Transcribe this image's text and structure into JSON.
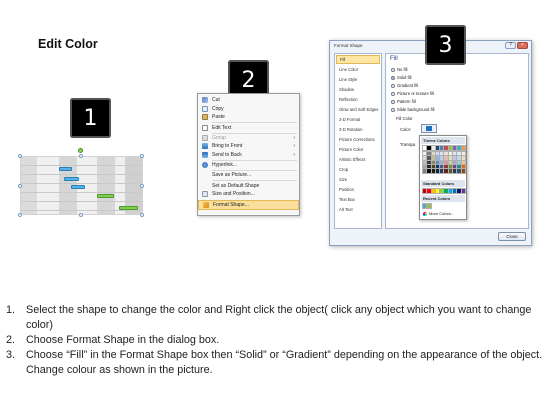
{
  "title": "Edit Color",
  "steps": {
    "one": "1",
    "two": "2",
    "three": "3"
  },
  "context_menu": {
    "items": [
      {
        "label": "Cut",
        "icon": "scissors-icon",
        "dim": false
      },
      {
        "label": "Copy",
        "icon": "copy-icon",
        "dim": false
      },
      {
        "label": "Paste",
        "icon": "paste-icon",
        "dim": false
      },
      {
        "label": "Edit Text",
        "icon": "edit-text-icon",
        "dim": false
      },
      {
        "label": "Group",
        "icon": "group-icon",
        "dim": true,
        "submenu": true
      },
      {
        "label": "Bring to Front",
        "icon": "bring-front-icon",
        "dim": false,
        "submenu": true
      },
      {
        "label": "Send to Back",
        "icon": "send-back-icon",
        "dim": false,
        "submenu": true
      },
      {
        "label": "Hyperlink...",
        "icon": "hyperlink-icon",
        "dim": false
      },
      {
        "label": "Save as Picture...",
        "icon": "",
        "dim": false
      },
      {
        "label": "Set as Default Shape",
        "icon": "",
        "dim": false
      },
      {
        "label": "Size and Position...",
        "icon": "size-icon",
        "dim": false
      },
      {
        "label": "Format Shape...",
        "icon": "format-shape-icon",
        "dim": false,
        "highlight": true
      }
    ]
  },
  "dialog": {
    "title": "Format Shape",
    "nav": [
      "Fill",
      "Line Color",
      "Line Style",
      "Shadow",
      "Reflection",
      "Glow and Soft Edges",
      "3-D Format",
      "3-D Rotation",
      "Picture Corrections",
      "Picture Color",
      "Artistic Effects",
      "Crop",
      "Size",
      "Position",
      "Text Box",
      "Alt Text"
    ],
    "active_nav": "Fill",
    "fill_heading": "Fill",
    "fill_options": [
      "No fill",
      "Solid fill",
      "Gradient fill",
      "Picture or texture fill",
      "Pattern fill"
    ],
    "selected_fill": "Solid fill",
    "slide_bg": "Slide background fill",
    "fill_color_heading": "Fill Color",
    "color_label": "Color:",
    "transparency_label": "Transpa",
    "close_label": "Close"
  },
  "color_popup": {
    "theme_label": "Theme Colors",
    "standard_label": "Standard Colors",
    "recent_label": "Recent Colors",
    "more_label": "More Colors...",
    "theme_top": [
      "#ffffff",
      "#000000",
      "#eeece1",
      "#1f497d",
      "#4f81bd",
      "#c0504d",
      "#9bbb59",
      "#8064a2",
      "#4bacc6",
      "#f79646"
    ],
    "theme_shades": [
      [
        "#f2f2f2",
        "#7f7f7f",
        "#ddd9c3",
        "#c6d9f0",
        "#dbe5f1",
        "#f2dcdb",
        "#ebf1dd",
        "#e5e0ec",
        "#dbeef3",
        "#fdeada"
      ],
      [
        "#d8d8d8",
        "#595959",
        "#c4bd97",
        "#8db3e2",
        "#b8cce4",
        "#e5b9b7",
        "#d7e3bc",
        "#ccc1d9",
        "#b7dde8",
        "#fbd5b5"
      ],
      [
        "#bfbfbf",
        "#3f3f3f",
        "#938953",
        "#548dd4",
        "#95b3d7",
        "#d99694",
        "#c3d69b",
        "#b2a2c7",
        "#92cddc",
        "#fac08f"
      ],
      [
        "#a5a5a5",
        "#262626",
        "#494429",
        "#17365d",
        "#366092",
        "#953734",
        "#76923c",
        "#5f497a",
        "#31859b",
        "#e36c09"
      ],
      [
        "#7f7f7f",
        "#0c0c0c",
        "#1d1b10",
        "#0f243e",
        "#244061",
        "#632423",
        "#4f6128",
        "#3f3151",
        "#205867",
        "#974806"
      ]
    ],
    "standard": [
      "#c00000",
      "#ff0000",
      "#ffc000",
      "#ffff00",
      "#92d050",
      "#00b050",
      "#00b0f0",
      "#0070c0",
      "#002060",
      "#7030a0"
    ],
    "recent": [
      "#4bacc6",
      "#9bbb59"
    ]
  },
  "instructions": [
    {
      "num": "1.",
      "text": "Select the shape to change the color and Right click the object( click any object which you want to change color)"
    },
    {
      "num": "2.",
      "text": "Choose Format Shape in the dialog box."
    },
    {
      "num": "3.",
      "text": "Choose “Fill” in the Format Shape box then “Solid” or “Gradient” depending on the appearance of the object. Change colour as shown in the picture."
    }
  ]
}
